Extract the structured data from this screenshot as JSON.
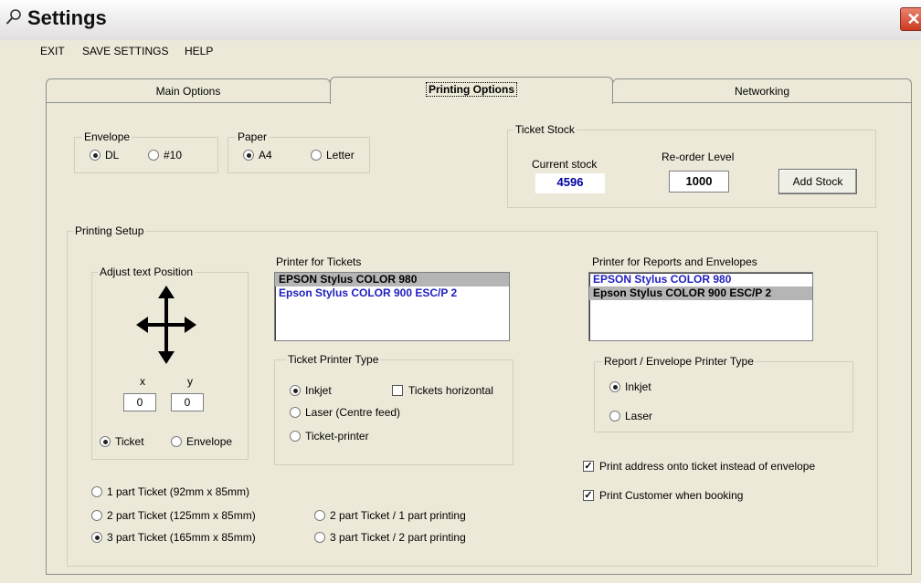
{
  "window": {
    "title": "Settings",
    "close_glyph": "✕"
  },
  "menu": {
    "exit": "EXIT",
    "save_settings": "SAVE SETTINGS",
    "help": "HELP"
  },
  "tabs": {
    "main": "Main Options",
    "printing": "Printing Options",
    "networking": "Networking"
  },
  "envelope": {
    "legend": "Envelope",
    "dl": "DL",
    "ten": "#10",
    "selected": "DL"
  },
  "paper": {
    "legend": "Paper",
    "a4": "A4",
    "letter": "Letter",
    "selected": "A4"
  },
  "ticket_stock": {
    "legend": "Ticket Stock",
    "current_label": "Current stock",
    "current_value": "4596",
    "reorder_label": "Re-order Level",
    "reorder_value": "1000",
    "add_button": "Add Stock"
  },
  "printing_setup": {
    "legend": "Printing Setup",
    "adjust": {
      "legend": "Adjust text Position",
      "x_label": "x",
      "y_label": "y",
      "x_value": "0",
      "y_value": "0",
      "ticket": "Ticket",
      "envelope": "Envelope",
      "selected": "Ticket",
      "arrow_icon": "four-way-arrow-icon"
    },
    "printer_tickets_label": "Printer for Tickets",
    "printer_tickets": [
      "EPSON Stylus COLOR 980",
      "Epson Stylus COLOR 900 ESC/P 2"
    ],
    "printer_reports_label": "Printer for Reports and Envelopes",
    "printer_reports": [
      "EPSON Stylus COLOR 980",
      "Epson Stylus COLOR 900 ESC/P 2"
    ],
    "ticket_type": {
      "legend": "Ticket Printer Type",
      "inkjet": "Inkjet",
      "laser": "Laser (Centre feed)",
      "ticket_printer": "Ticket-printer",
      "horizontal": "Tickets horizontal",
      "selected": "Inkjet"
    },
    "report_type": {
      "legend": "Report / Envelope Printer Type",
      "inkjet": "Inkjet",
      "laser": "Laser",
      "selected": "Inkjet"
    },
    "print_address": "Print address onto ticket instead of envelope",
    "print_customer": "Print Customer when booking",
    "parts": {
      "one": "1 part Ticket (92mm x 85mm)",
      "two": "2 part Ticket (125mm x 85mm)",
      "three": "3 part Ticket (165mm x 85mm)",
      "two_one": "2 part Ticket / 1 part printing",
      "three_two": "3 part Ticket / 2 part printing",
      "selected": "3 part Ticket (165mm x 85mm)"
    }
  }
}
